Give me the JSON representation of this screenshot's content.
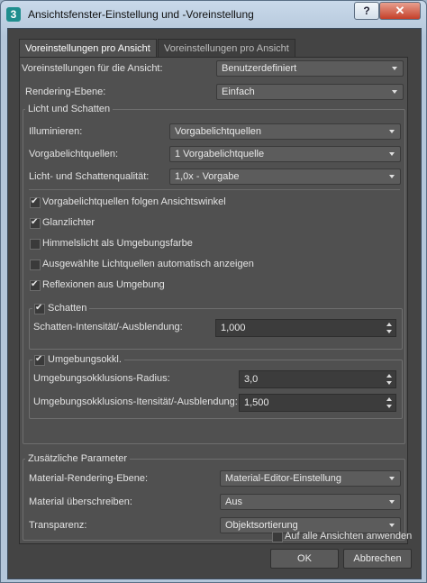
{
  "window": {
    "title": "Ansichtsfenster-Einstellung und -Voreinstellung",
    "app_icon": "3",
    "help_label": "?",
    "close_label": "✕"
  },
  "tabs": [
    {
      "label": "Voreinstellungen pro Ansicht"
    },
    {
      "label": "Voreinstellungen pro Ansicht"
    }
  ],
  "view_preset": {
    "label": "Voreinstellungen für die Ansicht:",
    "value": "Benutzerdefiniert"
  },
  "rendering_level": {
    "label": "Rendering-Ebene:",
    "value": "Einfach"
  },
  "lighting": {
    "group_title": "Licht und Schatten",
    "illuminate": {
      "label": "Illuminieren:",
      "value": "Vorgabelichtquellen"
    },
    "default_lights": {
      "label": "Vorgabelichtquellen:",
      "value": "1 Vorgabelichtquelle"
    },
    "quality": {
      "label": "Licht- und Schattenqualität:",
      "value": "1,0x - Vorgabe"
    },
    "checkboxes": [
      {
        "label": "Vorgabelichtquellen folgen Ansichtswinkel",
        "checked": true
      },
      {
        "label": "Glanzlichter",
        "checked": true
      },
      {
        "label": "Himmelslicht als Umgebungsfarbe",
        "checked": false
      },
      {
        "label": "Ausgewählte Lichtquellen automatisch anzeigen",
        "checked": false
      },
      {
        "label": "Reflexionen aus Umgebung",
        "checked": true
      }
    ],
    "shadows": {
      "title": "Schatten",
      "checked": true,
      "intensity_label": "Schatten-Intensität/-Ausblendung:",
      "intensity_value": "1,000"
    },
    "ambient_occlusion": {
      "title": "Umgebungsokkl.",
      "checked": true,
      "radius_label": "Umgebungsokklusions-Radius:",
      "radius_value": "3,0",
      "intensity_label": "Umgebungsokklusions-Itensität/-Ausblendung:",
      "intensity_value": "1,500"
    }
  },
  "additional": {
    "group_title": "Zusätzliche Parameter",
    "material_rendering": {
      "label": "Material-Rendering-Ebene:",
      "value": "Material-Editor-Einstellung"
    },
    "override_material": {
      "label": "Material überschreiben:",
      "value": "Aus"
    },
    "transparency": {
      "label": "Transparenz:",
      "value": "Objektsortierung"
    }
  },
  "apply_all": {
    "label": "Auf alle Ansichten anwenden",
    "checked": false
  },
  "buttons": {
    "ok": "OK",
    "cancel": "Abbrechen"
  }
}
